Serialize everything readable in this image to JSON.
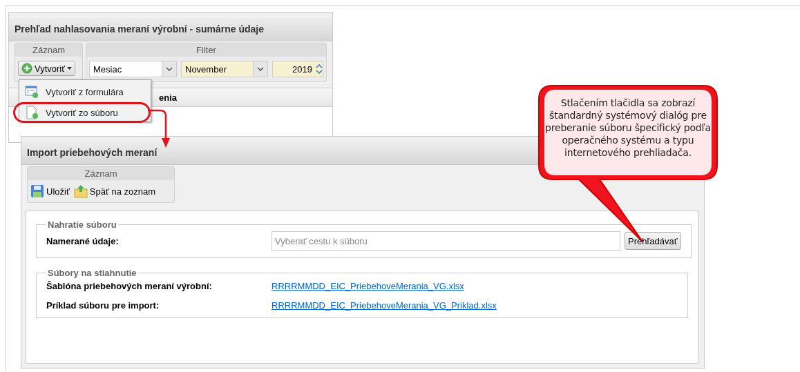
{
  "list_window": {
    "title": "Prehľad nahlasovania meraní výrobní - sumárne údaje",
    "record_group": {
      "label": "Záznam",
      "create_button": "Vytvoriť"
    },
    "filter_group": {
      "label": "Filter",
      "period": "Mesiac",
      "month": "November",
      "year": "2019"
    },
    "grid": {
      "column_1": "enia"
    }
  },
  "create_menu": {
    "items": [
      {
        "kind": "form",
        "label": "Vytvoriť z formulára",
        "highlighted": false
      },
      {
        "kind": "file",
        "label": "Vytvoriť zo súboru",
        "highlighted": true
      }
    ]
  },
  "import_window": {
    "title": "Import priebehových meraní",
    "record_group": {
      "label": "Záznam",
      "buttons": [
        {
          "kind": "save",
          "label": "Uložiť"
        },
        {
          "kind": "back",
          "label": "Späť na zoznam"
        }
      ]
    },
    "upload": {
      "legend": "Nahratie súboru",
      "label": "Namerané údaje:",
      "placeholder": "Vyberať cestu k súboru",
      "browse_button": "Prehľadávať"
    },
    "downloads": {
      "legend": "Súbory na stiahnutie",
      "rows": [
        {
          "label": "Šablóna priebehových meraní výrobní:",
          "link": "RRRRMMDD_EIC_PriebehoveMerania_VG.xlsx"
        },
        {
          "label": "Príklad súboru pre import:",
          "link": "RRRRMMDD_EIC_PriebehoveMerania_VG_Priklad.xlsx"
        }
      ]
    }
  },
  "callout": {
    "text": "Stlačením tlačidla sa zobrazí štandardný systémový dialóg pre preberanie súboru špecifický podľa operačného systému a typu internetového prehliadača."
  }
}
